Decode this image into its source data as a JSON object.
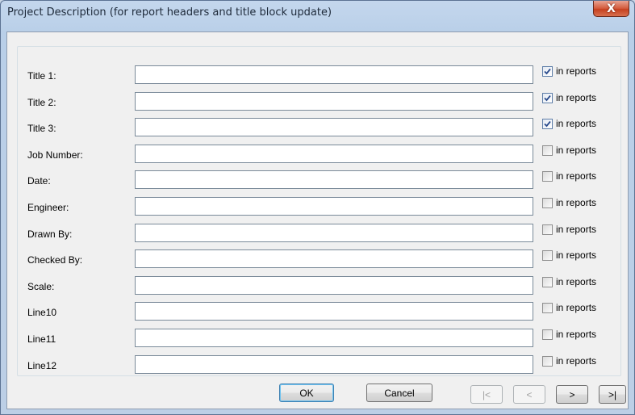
{
  "window": {
    "title": "Project Description  (for report headers and title block update)",
    "close_glyph": "X"
  },
  "fields": [
    {
      "label": "Title 1:",
      "value": "",
      "checked": true,
      "checkbox_label": "in reports"
    },
    {
      "label": "Title 2:",
      "value": "",
      "checked": true,
      "checkbox_label": "in reports"
    },
    {
      "label": "Title 3:",
      "value": "",
      "checked": true,
      "checkbox_label": "in reports"
    },
    {
      "label": "Job Number:",
      "value": "",
      "checked": false,
      "checkbox_label": "in reports"
    },
    {
      "label": "Date:",
      "value": "",
      "checked": false,
      "checkbox_label": "in reports"
    },
    {
      "label": "Engineer:",
      "value": "",
      "checked": false,
      "checkbox_label": "in reports"
    },
    {
      "label": "Drawn By:",
      "value": "",
      "checked": false,
      "checkbox_label": "in reports"
    },
    {
      "label": "Checked By:",
      "value": "",
      "checked": false,
      "checkbox_label": "in reports"
    },
    {
      "label": "Scale:",
      "value": "",
      "checked": false,
      "checkbox_label": "in reports"
    },
    {
      "label": "Line10",
      "value": "",
      "checked": false,
      "checkbox_label": "in reports"
    },
    {
      "label": "Line11",
      "value": "",
      "checked": false,
      "checkbox_label": "in reports"
    },
    {
      "label": "Line12",
      "value": "",
      "checked": false,
      "checkbox_label": "in reports"
    }
  ],
  "buttons": {
    "ok": "OK",
    "cancel": "Cancel",
    "first": "|<",
    "prev": "<",
    "next": ">",
    "last": ">|"
  }
}
